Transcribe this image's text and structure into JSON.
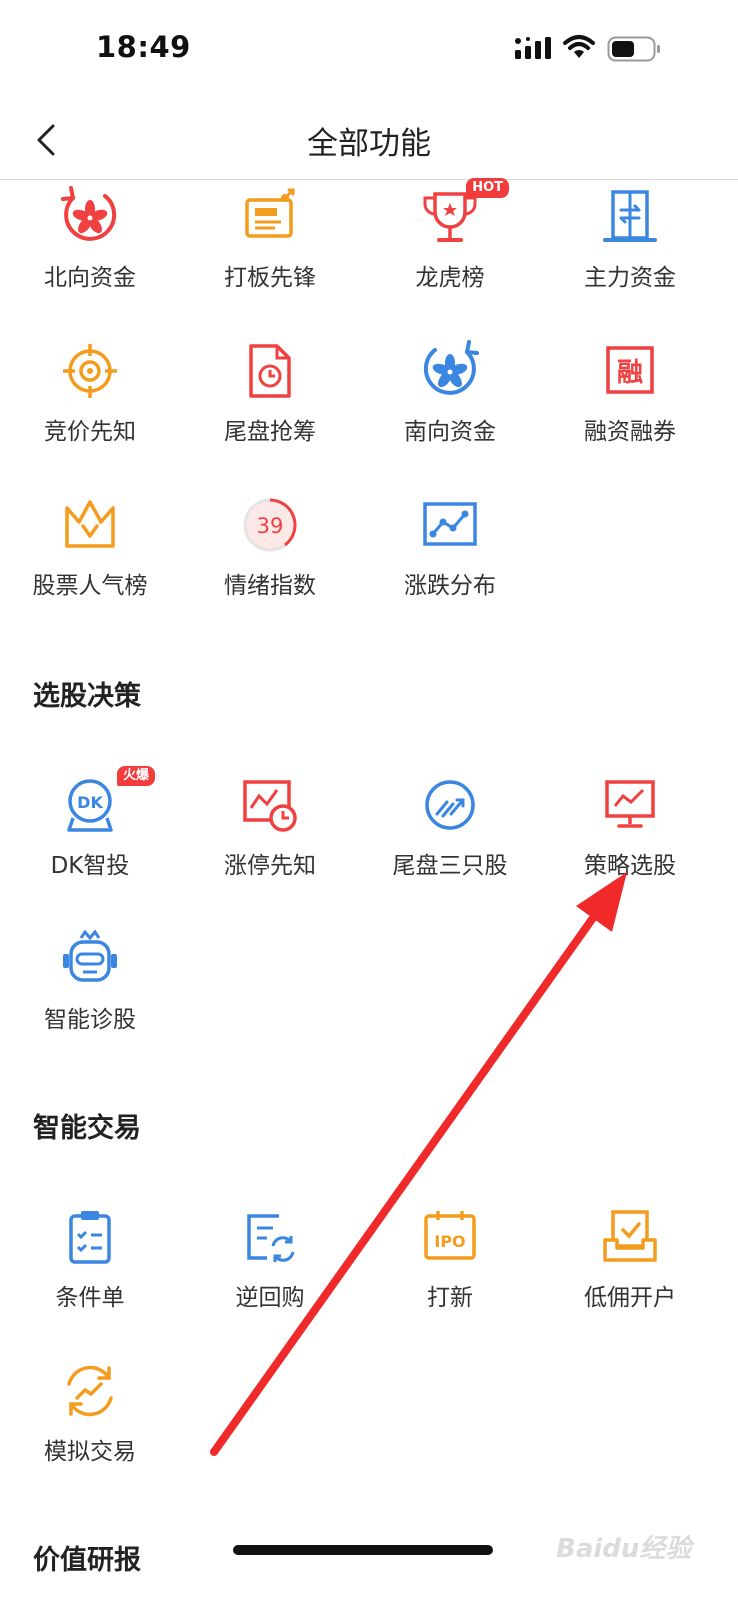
{
  "status_bar": {
    "time": "18:49"
  },
  "header": {
    "title": "全部功能"
  },
  "row_group_1": {
    "items": [
      {
        "label": "北向资金",
        "icon": "northbound-capital-icon"
      },
      {
        "label": "打板先锋",
        "icon": "board-pioneer-icon"
      },
      {
        "label": "龙虎榜",
        "icon": "trophy-icon",
        "badge": "HOT"
      },
      {
        "label": "主力资金",
        "icon": "main-capital-icon"
      },
      {
        "label": "竞价先知",
        "icon": "target-icon"
      },
      {
        "label": "尾盘抢筹",
        "icon": "document-clock-icon"
      },
      {
        "label": "南向资金",
        "icon": "southbound-capital-icon"
      },
      {
        "label": "融资融券",
        "icon": "margin-trading-icon",
        "icon_text": "融"
      },
      {
        "label": "股票人气榜",
        "icon": "crown-icon"
      },
      {
        "label": "情绪指数",
        "icon": "gauge-icon",
        "icon_text": "39"
      },
      {
        "label": "涨跌分布",
        "icon": "line-chart-icon"
      }
    ]
  },
  "section_stock_picking": {
    "title": "选股决策",
    "items": [
      {
        "label": "DK智投",
        "icon": "dk-robot-icon",
        "badge": "火爆",
        "icon_text": "DK"
      },
      {
        "label": "涨停先知",
        "icon": "limit-up-clock-icon"
      },
      {
        "label": "尾盘三只股",
        "icon": "closing-picks-icon"
      },
      {
        "label": "策略选股",
        "icon": "strategy-monitor-icon"
      },
      {
        "label": "智能诊股",
        "icon": "robot-diagnosis-icon"
      }
    ]
  },
  "section_smart_trading": {
    "title": "智能交易",
    "items": [
      {
        "label": "条件单",
        "icon": "clipboard-icon"
      },
      {
        "label": "逆回购",
        "icon": "refresh-document-icon"
      },
      {
        "label": "打新",
        "icon": "ipo-calendar-icon",
        "icon_text": "IPO"
      },
      {
        "label": "低佣开户",
        "icon": "account-open-icon"
      },
      {
        "label": "模拟交易",
        "icon": "simulated-trade-icon"
      }
    ]
  },
  "section_value_research": {
    "title": "价值研报"
  },
  "watermark": {
    "text": "Baidu经验"
  },
  "colors": {
    "red": "#f04040",
    "orange": "#f39c1d",
    "blue": "#3a86e0",
    "arrow": "#f02a2a"
  }
}
